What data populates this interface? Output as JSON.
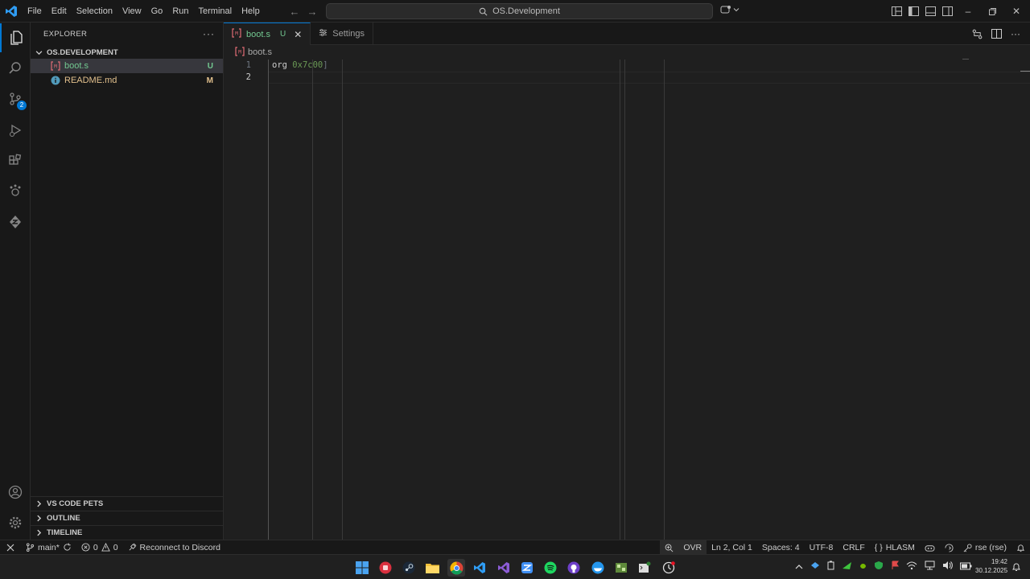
{
  "titlebar": {
    "menu": [
      "File",
      "Edit",
      "Selection",
      "View",
      "Go",
      "Run",
      "Terminal",
      "Help"
    ],
    "search_text": "OS.Development"
  },
  "activitybar": {
    "source_control_badge": "2",
    "items": [
      "explorer-icon",
      "search-icon",
      "source-control-icon",
      "run-debug-icon",
      "extensions-icon",
      "pets-icon",
      "zed-icon",
      "account-icon",
      "settings-gear-icon"
    ]
  },
  "sidebar": {
    "title": "EXPLORER",
    "folder": "OS.DEVELOPMENT",
    "files": [
      {
        "name": "boot.s",
        "status": "U"
      },
      {
        "name": "README.md",
        "status": "M"
      }
    ],
    "sections": [
      "VS CODE PETS",
      "OUTLINE",
      "TIMELINE"
    ]
  },
  "tabs": [
    {
      "label": "boot.s",
      "status": "U"
    },
    {
      "label": "Settings"
    }
  ],
  "breadcrumb": "boot.s",
  "editor": {
    "line_numbers": [
      "1",
      "2"
    ],
    "line1_keyword": "org",
    "line1_value": "0x7c00"
  },
  "statusbar": {
    "branch": "main*",
    "errors": "0",
    "warnings": "0",
    "discord": "Reconnect to Discord",
    "ovr": "OVR",
    "position": "Ln 2, Col 1",
    "spaces": "Spaces: 4",
    "encoding": "UTF-8",
    "eol": "CRLF",
    "language": "HLASM",
    "remote_user": "rse (rse)"
  },
  "taskbar": {
    "time": "19:42",
    "date": "30.12.2025"
  },
  "colors": {
    "accent": "#0078d4",
    "untracked": "#73c991",
    "modified": "#e2c08d"
  }
}
